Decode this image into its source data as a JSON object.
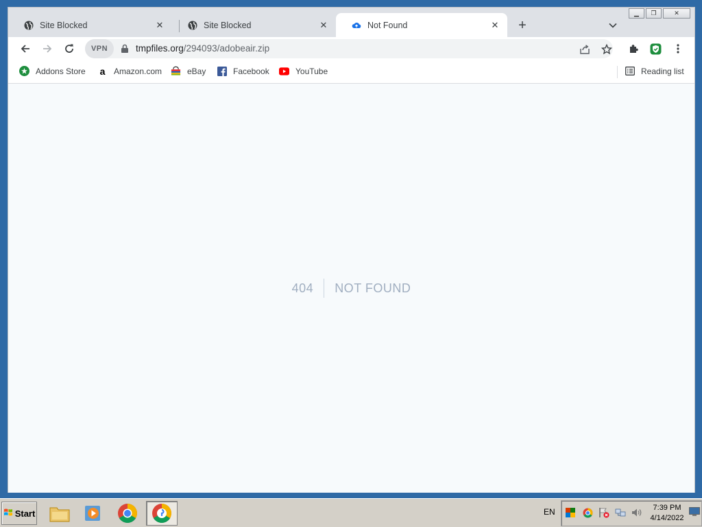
{
  "browser": {
    "tabs": [
      {
        "label": "Site Blocked",
        "icon": "globe-icon",
        "active": false
      },
      {
        "label": "Site Blocked",
        "icon": "globe-icon",
        "active": false
      },
      {
        "label": "Not Found",
        "icon": "cloud-upload-icon",
        "active": true
      }
    ],
    "new_tab_label": "+",
    "vpn_label": "VPN",
    "url_domain": "tmpfiles.org",
    "url_path": "/294093/adobeair.zip",
    "bookmarks": [
      {
        "label": "Addons Store",
        "icon": "addons-store-icon"
      },
      {
        "label": "Amazon.com",
        "icon": "amazon-icon"
      },
      {
        "label": "eBay",
        "icon": "ebay-icon"
      },
      {
        "label": "Facebook",
        "icon": "facebook-icon"
      },
      {
        "label": "YouTube",
        "icon": "youtube-icon"
      }
    ],
    "reading_list_label": "Reading list"
  },
  "page": {
    "error_code": "404",
    "error_message": "NOT FOUND"
  },
  "taskbar": {
    "start_label": "Start",
    "language": "EN",
    "time": "7:39 PM",
    "date": "4/14/2022"
  },
  "colors": {
    "desktop": "#2f6aa6",
    "page_background": "#f7fafc",
    "error_text": "#a0aec0",
    "vpn_badge_green": "#1e8e3e"
  }
}
